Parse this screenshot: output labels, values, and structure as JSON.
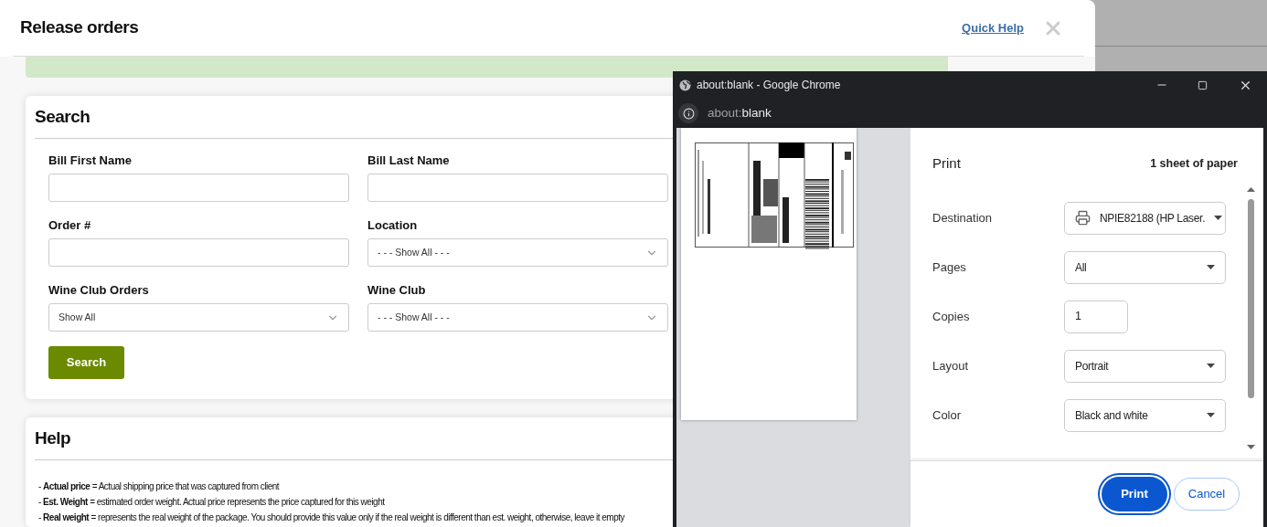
{
  "modal": {
    "title": "Release orders",
    "quick_help": "Quick Help"
  },
  "search": {
    "title": "Search",
    "fields": [
      {
        "label": "Bill First Name",
        "kind": "text"
      },
      {
        "label": "Bill Last Name",
        "kind": "text"
      },
      {
        "label": "Order #",
        "kind": "text"
      },
      {
        "label": "Location",
        "kind": "select",
        "value": "- - - Show All - - -"
      },
      {
        "label": "Wine Club Orders",
        "kind": "select",
        "value": "Show All"
      },
      {
        "label": "Wine Club",
        "kind": "select",
        "value": "- - - Show All - - -"
      }
    ],
    "button": "Search"
  },
  "help": {
    "title": "Help",
    "lines": [
      "- **Actual price** = Actual shipping price that was captured from client",
      "- **Est. Weight** = estimated order weight. Actual price represents the price captured for this weight",
      "- **Real weight** = represents the real weight of the package. You should provide this value only if the real weight is different than est. weight, otherwise, leave it empty"
    ]
  },
  "chrome": {
    "title": "about:blank - Google Chrome",
    "address_scheme": "about:",
    "address_rest": "blank",
    "print": {
      "title": "Print",
      "sheets": "1 sheet of paper",
      "settings": [
        {
          "label": "Destination",
          "kind": "printer",
          "value": "NPIE82188 (HP Laser."
        },
        {
          "label": "Pages",
          "kind": "select",
          "value": "All"
        },
        {
          "label": "Copies",
          "kind": "number",
          "value": "1"
        },
        {
          "label": "Layout",
          "kind": "select",
          "value": "Portrait"
        },
        {
          "label": "Color",
          "kind": "select",
          "value": "Black and white"
        }
      ],
      "buttons": [
        {
          "label": "Print",
          "kind": "primary"
        },
        {
          "label": "Cancel",
          "kind": "secondary"
        }
      ]
    }
  }
}
